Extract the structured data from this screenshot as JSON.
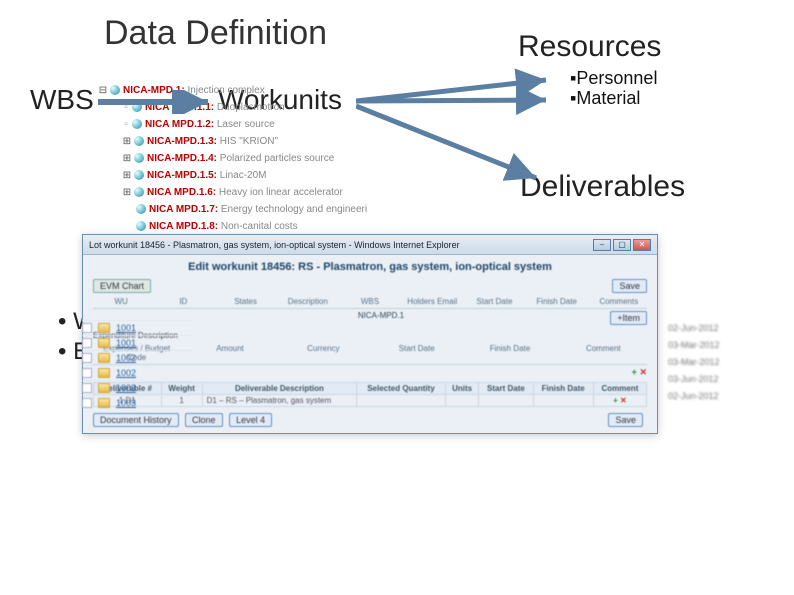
{
  "title": "Data Definition",
  "wbs_label": "WBS",
  "workunits_label": "Workunits",
  "resources_label": "Resources",
  "resources_items": {
    "a": "Personnel",
    "b": "Material"
  },
  "deliverables_label": "Deliverables",
  "bullets": {
    "a": "Web interface",
    "b": "Excel files"
  },
  "tree": {
    "root": {
      "id": "NICA-MPD.1:",
      "desc": "Injection complex"
    },
    "items": [
      {
        "id": "NICA MPD.1.1:",
        "desc": "Duoplasmotron"
      },
      {
        "id": "NICA MPD.1.2:",
        "desc": "Laser source"
      },
      {
        "id": "NICA-MPD.1.3:",
        "desc": "HIS \"KRION\""
      },
      {
        "id": "NICA-MPD.1.4:",
        "desc": "Polarized particles source"
      },
      {
        "id": "NICA-MPD.1.5:",
        "desc": "Linac-20M"
      },
      {
        "id": "NICA MPD.1.6:",
        "desc": "Heavy ion linear accelerator"
      },
      {
        "id": "NICA MPD.1.7:",
        "desc": "Energy technology and engineeri"
      },
      {
        "id": "NICA MPD.1.8:",
        "desc": "Non-canital costs"
      }
    ]
  },
  "dialog": {
    "window_title": "Lot workunit 18456 - Plasmatron, gas system, ion-optical system - Windows Internet Explorer",
    "header": "Edit workunit 18456: RS - Plasmatron, gas system, ion-optical system",
    "evm_btn": "EVM Chart",
    "save_btn": "Save",
    "cols1": [
      "WU",
      "ID",
      "States",
      "Description",
      "WBS",
      "Holders Email",
      "Start Date",
      "Finish Date",
      "Comments"
    ],
    "wbs_val": "NICA-MPD.1",
    "section2": "Expenditure Description",
    "cols2": [
      "Expenses / Budget Code",
      "Amount",
      "Currency",
      "Start Date",
      "Finish Date",
      "Comment"
    ],
    "section3": "Deliverable #",
    "cols3": [
      "Weight",
      "Deliverable Description",
      "Selected Quantity",
      "Units",
      "Start Date",
      "Finish Date",
      "Comment"
    ],
    "deliv_row": {
      "num": "1",
      "id": "D1",
      "weight": "1",
      "desc": "D1 – RS – Plasmatron, gas system"
    },
    "btn_history": "Document History",
    "btn_clone": "Clone",
    "btn_level": "Level 4"
  },
  "listing": {
    "rows": [
      {
        "id": "1001"
      },
      {
        "id": "1001"
      },
      {
        "id": "1002"
      },
      {
        "id": "1002"
      },
      {
        "id": "1003"
      },
      {
        "id": "1003"
      }
    ]
  },
  "dates": [
    "02-Jun-2012",
    "03-Mar-2012",
    "03-Mar-2012",
    "03-Jun-2012",
    "02-Jun-2012"
  ],
  "chart_data": null
}
